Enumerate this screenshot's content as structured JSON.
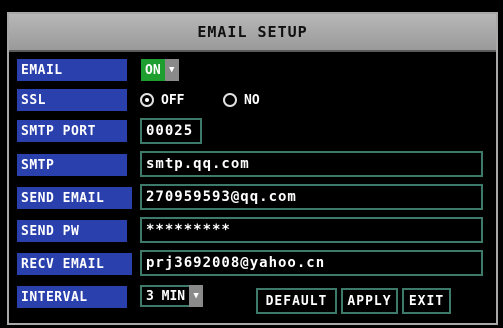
{
  "title": "EMAIL SETUP",
  "labels": {
    "email": "EMAIL",
    "ssl": "SSL",
    "smtp_port": "SMTP PORT",
    "smtp": "SMTP",
    "send_email": "SEND EMAIL",
    "send_pw": "SEND PW",
    "recv_email": "RECV EMAIL",
    "interval": "INTERVAL"
  },
  "email_toggle": {
    "value": "ON",
    "arrow_icon": "chevron-down-icon"
  },
  "ssl": {
    "options": [
      "OFF",
      "NO"
    ],
    "selected": "OFF"
  },
  "fields": {
    "smtp_port": "00025",
    "smtp": "smtp.qq.com",
    "send_email": "270959593@qq.com",
    "send_pw": "*********",
    "recv_email": "prj3692008@yahoo.cn"
  },
  "interval": {
    "value": "3 MIN"
  },
  "buttons": {
    "default": "DEFAULT",
    "apply": "APPLY",
    "exit": "EXIT"
  },
  "colors": {
    "label_bg": "#2a40ad",
    "toggle_on": "#1e9e2e",
    "field_border": "#3d7a6a",
    "title_bg": "#a8a8a8"
  }
}
